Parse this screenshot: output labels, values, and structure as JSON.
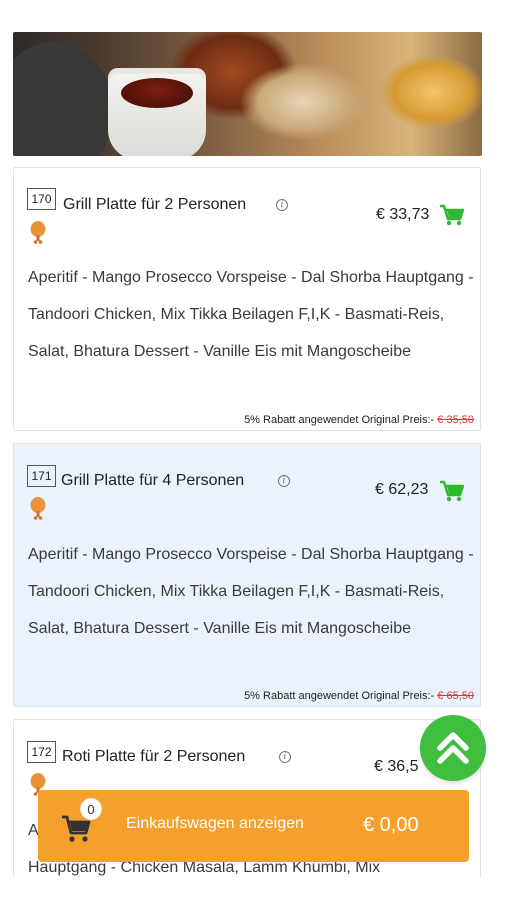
{
  "menu": {
    "items": [
      {
        "number": "170",
        "title": "Grill Platte für 2 Personen",
        "price": "€ 33,73",
        "description": "Aperitif - Mango Prosecco Vorspeise - Dal Shorba Hauptgang - Tandoori Chicken, Mix Tikka Beilagen F,I,K - Basmati-Reis, Salat, Bhatura Dessert - Vanille Eis mit Mangoscheibe",
        "discount_text": "5% Rabatt angewendet Original Preis:-",
        "original_price": "€ 35,50"
      },
      {
        "number": "171",
        "title": "Grill Platte für 4 Personen",
        "price": "€ 62,23",
        "description": "Aperitif - Mango Prosecco Vorspeise - Dal Shorba Hauptgang - Tandoori Chicken, Mix Tikka Beilagen F,I,K - Basmati-Reis, Salat, Bhatura Dessert - Vanille Eis mit Mangoscheibe",
        "discount_text": "5% Rabatt angewendet Original Preis:-",
        "original_price": "€ 65,50"
      },
      {
        "number": "172",
        "title": "Roti Platte für 2 Personen",
        "price": "€ 36,5",
        "description": "A",
        "description_line2": "Hauptgang - Chicken Masala, Lamm Khumbi, Mix"
      }
    ]
  },
  "cart": {
    "count": "0",
    "label": "Einkaufswagen anzeigen",
    "total": "€ 0,00"
  },
  "icons": {
    "info": "info-icon",
    "meat": "chicken-leg-icon",
    "add_to_cart": "cart-icon",
    "scroll_top": "double-chevron-up-icon"
  },
  "colors": {
    "accent_green": "#3fbe3f",
    "cart_bar": "#f5a02d",
    "highlight_card": "#eaf2fb",
    "strike_price": "#dd3333"
  }
}
